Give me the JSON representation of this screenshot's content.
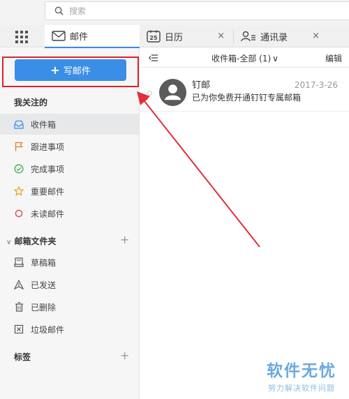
{
  "search": {
    "placeholder": "搜索"
  },
  "tabs": [
    {
      "label": "邮件",
      "icon": "mail-icon",
      "active": true
    },
    {
      "label": "日历",
      "icon": "calendar-icon",
      "icon_text": "25",
      "close": "×"
    },
    {
      "label": "通讯录",
      "icon": "contacts-icon",
      "close": "×"
    }
  ],
  "sidebar": {
    "compose_label": "写邮件",
    "compose_plus": "+",
    "follow_title": "我关注的",
    "follow_items": [
      {
        "label": "收件箱",
        "icon": "inbox-icon",
        "active": true
      },
      {
        "label": "跟进事项",
        "icon": "flag-icon"
      },
      {
        "label": "完成事项",
        "icon": "check-circle-icon"
      },
      {
        "label": "重要邮件",
        "icon": "star-icon"
      },
      {
        "label": "未读邮件",
        "icon": "unread-circle-icon"
      }
    ],
    "folder_title": "邮箱文件夹",
    "folder_plus": "+",
    "folder_items": [
      {
        "label": "草稿箱",
        "icon": "draft-icon"
      },
      {
        "label": "已发送",
        "icon": "sent-icon"
      },
      {
        "label": "已删除",
        "icon": "trash-icon"
      },
      {
        "label": "垃圾邮件",
        "icon": "spam-icon"
      }
    ],
    "tags_title": "标签",
    "tags_plus": "+"
  },
  "list": {
    "folder_label": "收件箱-全部 (1)",
    "folder_chevron": "∨",
    "edit_label": "编辑",
    "mails": [
      {
        "sender": "钉邮",
        "date": "2017-3-26",
        "subject": "已为你免费开通钉钉专属邮箱"
      }
    ]
  },
  "watermark": {
    "title": "软件无忧",
    "subtitle": "努力解决软件问题"
  },
  "colors": {
    "accent": "#3b8ee6",
    "highlight_box": "#d9232d",
    "arrow": "#e0303c"
  }
}
